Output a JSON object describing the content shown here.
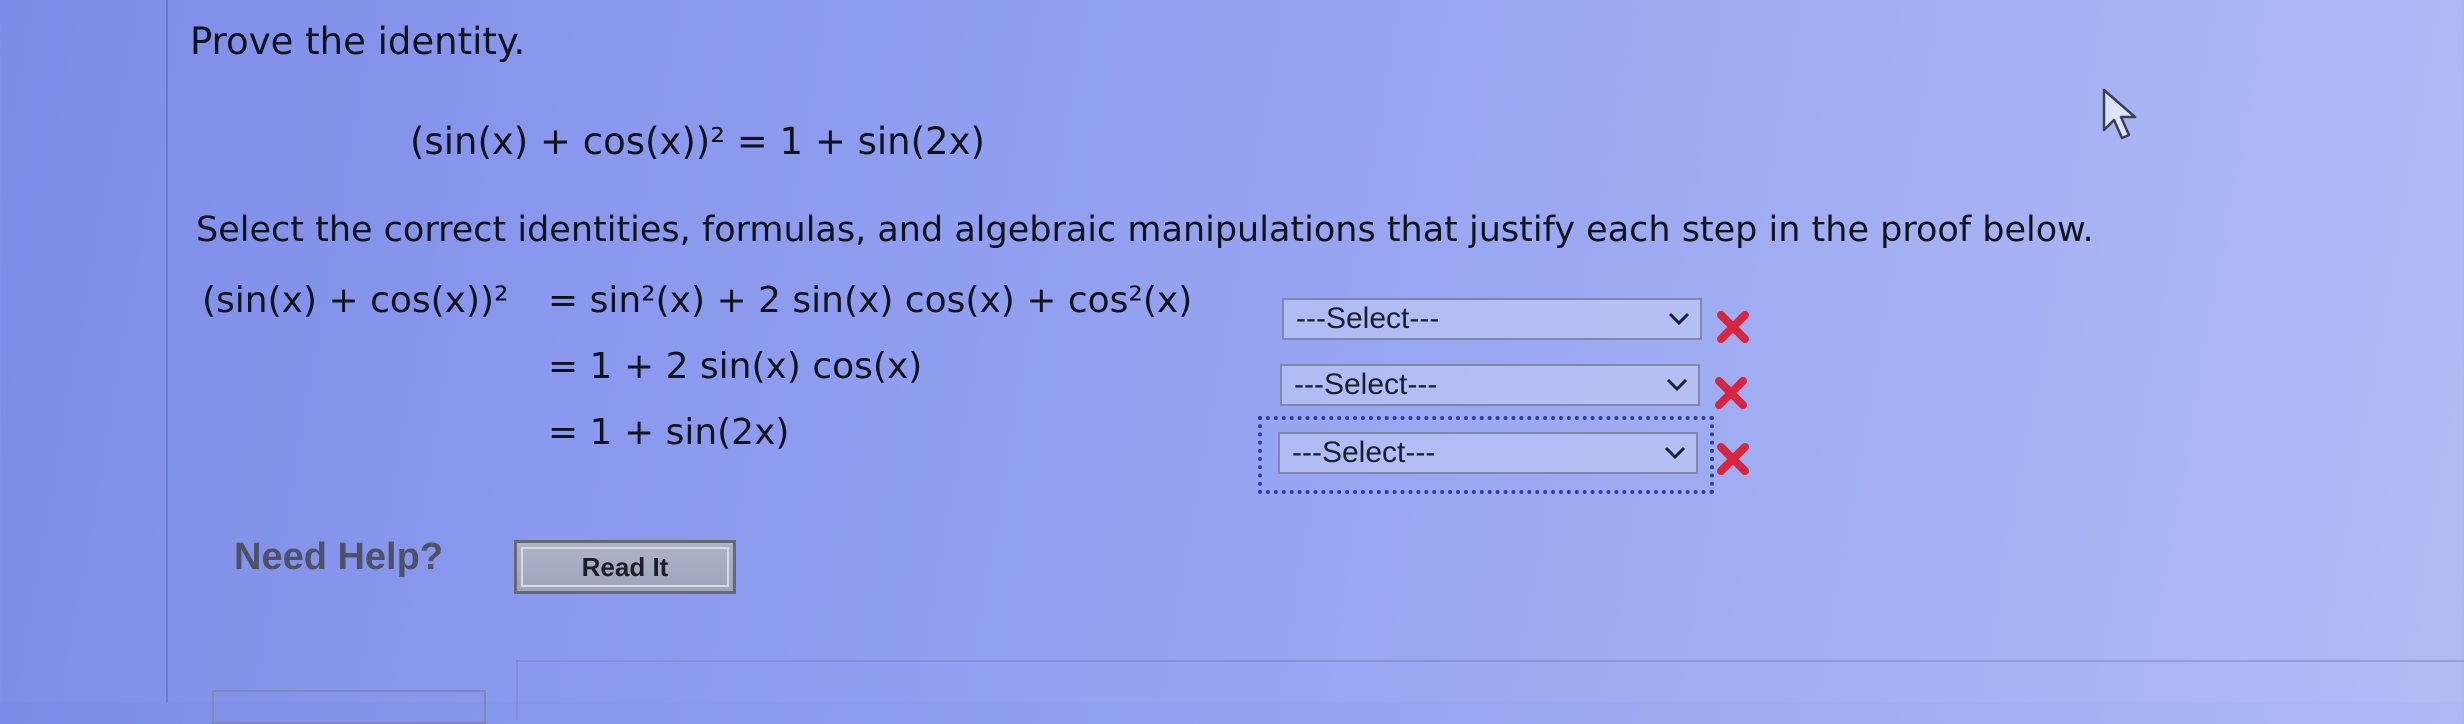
{
  "problem": {
    "title": "Prove the identity.",
    "identity": "(sin(x) + cos(x))² = 1 + sin(2x)",
    "instruction": "Select the correct identities, formulas, and algebraic manipulations that justify each step in the proof below."
  },
  "proof": {
    "lhs": "(sin(x) + cos(x))²",
    "steps": [
      {
        "expression": "= sin²(x) + 2 sin(x) cos(x) + cos²(x)",
        "select_value": "---Select---",
        "status": "incorrect"
      },
      {
        "expression": "= 1 + 2 sin(x) cos(x)",
        "select_value": "---Select---",
        "status": "incorrect"
      },
      {
        "expression": "= 1 + sin(2x)",
        "select_value": "---Select---",
        "status": "incorrect"
      }
    ]
  },
  "help": {
    "label": "Need Help?",
    "button_label": "Read It"
  },
  "colors": {
    "incorrect_mark": "#d7263d",
    "focus_ring": "#2f3ea0",
    "background_start": "#7d8ce6",
    "background_end": "#b2bcf4"
  },
  "icons": {
    "step_status": "x-mark-icon",
    "dropdown": "chevron-down-icon",
    "pointer": "mouse-cursor-icon"
  }
}
